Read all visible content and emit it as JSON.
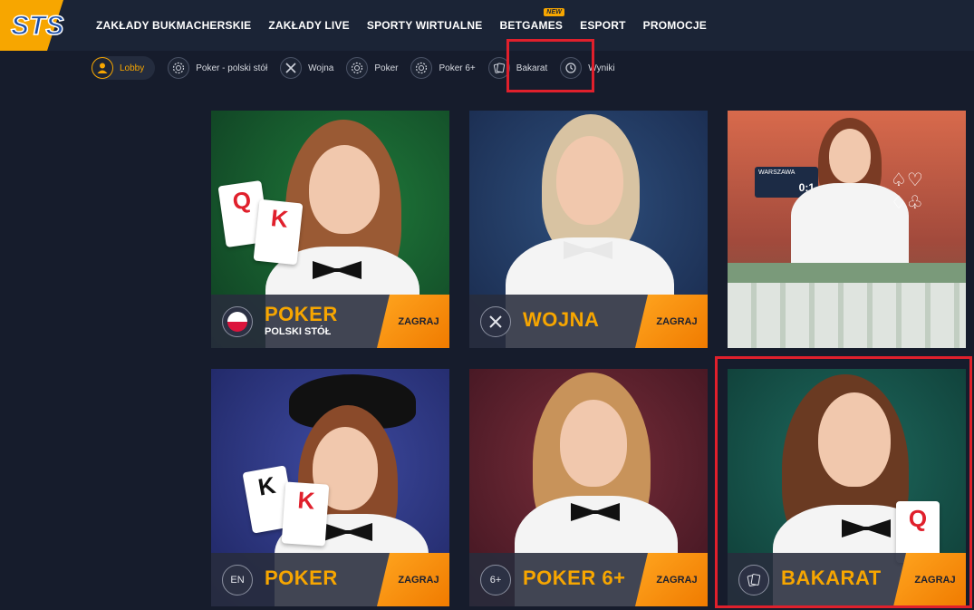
{
  "header": {
    "logo_text": "STS",
    "nav": [
      {
        "label": "ZAKŁADY BUKMACHERSKIE"
      },
      {
        "label": "ZAKŁADY LIVE"
      },
      {
        "label": "SPORTY WIRTUALNE"
      },
      {
        "label": "BETGAMES",
        "badge": "NEW"
      },
      {
        "label": "ESPORT"
      },
      {
        "label": "PROMOCJE"
      }
    ]
  },
  "subnav": [
    {
      "label": "Lobby",
      "icon": "dealer-icon"
    },
    {
      "label": "Poker - polski stół",
      "icon": "poker-chip-icon"
    },
    {
      "label": "Wojna",
      "icon": "crossed-swords-icon"
    },
    {
      "label": "Poker",
      "icon": "poker-chip-icon"
    },
    {
      "label": "Poker 6+",
      "icon": "poker-chip-icon"
    },
    {
      "label": "Bakarat",
      "icon": "cards-icon"
    },
    {
      "label": "Wyniki",
      "icon": "history-icon"
    }
  ],
  "cards": [
    {
      "title": "POKER",
      "subtitle": "POLSKI STÓŁ",
      "play": "ZAGRAJ",
      "icon": "poland-flag-icon"
    },
    {
      "title": "WOJNA",
      "subtitle": "",
      "play": "ZAGRAJ",
      "icon": "crossed-swords-icon"
    },
    {
      "title": "",
      "subtitle": "",
      "play": "",
      "icon": "",
      "live_labels": {
        "table": "WARSZAWA",
        "score": "0:1"
      }
    },
    {
      "title": "POKER",
      "subtitle": "",
      "play": "ZAGRAJ",
      "icon": "poker-chip-icon",
      "icon_text": "EN"
    },
    {
      "title": "POKER 6+",
      "subtitle": "",
      "play": "ZAGRAJ",
      "icon": "poker-chip-icon",
      "icon_text": "6+"
    },
    {
      "title": "BAKARAT",
      "subtitle": "",
      "play": "ZAGRAJ",
      "icon": "cards-icon"
    }
  ],
  "colors": {
    "accent": "#f7a600",
    "background": "#161c2c",
    "header": "#1b2436",
    "highlight": "#e0202c"
  }
}
